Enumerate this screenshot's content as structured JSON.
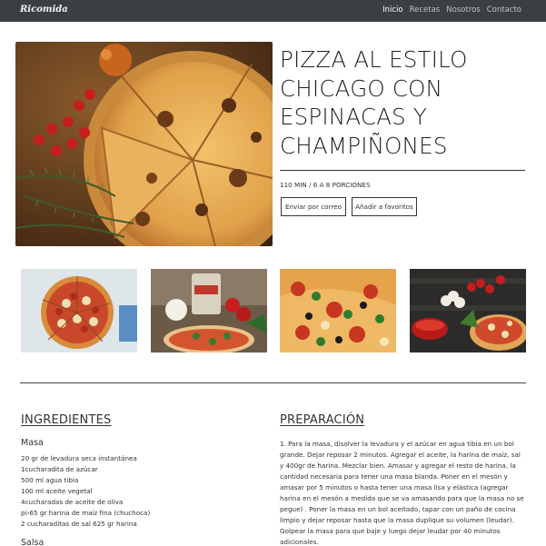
{
  "brand": "Ricomida",
  "nav": {
    "items": [
      "Inicio",
      "Recetas",
      "Nosotros",
      "Contacto"
    ]
  },
  "recipe": {
    "title_lines": [
      "PIZZA AL ESTILO",
      "CHICAGO CON",
      "ESPINACAS Y",
      "CHAMPIÑONES"
    ],
    "meta": "110 MIN / 6 A 8 PORCIONES",
    "email_button": "Enviar por correo",
    "favorite_button": "Añadir a favoritos"
  },
  "ingredients": {
    "heading": "INGREDIENTES",
    "subheading_1": "Masa",
    "items": [
      "20 gr de levadura seca instantánea",
      "1cucharadita de azúcar",
      "500 ml agua tibia",
      "100 ml aceite vegetal",
      "4cucharadas de aceite de oliva",
      "pi›65 gr harina de maíz fina (chuchoca)",
      "2 cucharaditas de sal 625 gr harina"
    ],
    "subheading_2": "Salsa"
  },
  "preparation": {
    "heading": "PREPARACIÓN",
    "text": "1. Para la masa, disolver la levadura y el azúcar en agua tibia en un bol grande. Dejar reposar 2 minutos. Agregar el aceite, la harina de maíz, sal y 400gr de harina. Mezclar bien. Amasar y agregar el resto de harina, la cantidad necesaria para tener una masa blanda. Poner en el mesón y amasar por 5 minutos o hasta tener una masa lisa y elástica (agregar harina en el mesón a medida que se va amasando para que la masa no se pegue) . Poner la masa en un bol aceitado, tapar con un paño de cocina limpio y dejar reposar hasta que la masa duplique su volumen (leudar). Golpear la masa para que baje y luego dejar leudar por 40 minutos adicionales."
  },
  "colors": {
    "navbar": "#3b3f44",
    "text": "#333333"
  }
}
